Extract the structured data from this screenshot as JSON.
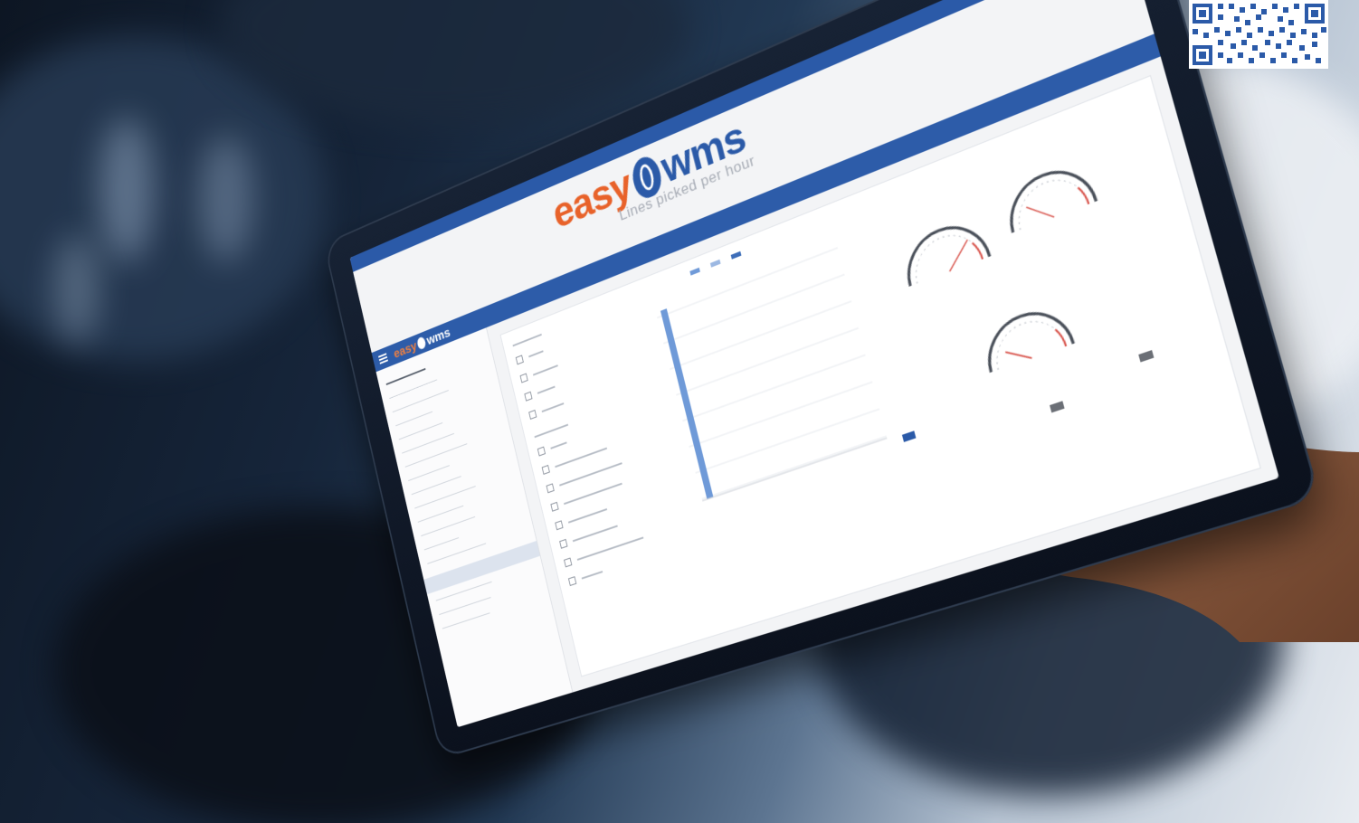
{
  "header": {
    "logo_easy": "easy",
    "logo_wms": "wms"
  },
  "appbar": {
    "logo_easy": "easy",
    "logo_wms": "wms"
  },
  "page": {
    "title": "Lines picked per hour"
  },
  "colors": {
    "brand_blue": "#2b5aa8",
    "brand_orange": "#e8622a",
    "chart_bar": "#6f9ad8"
  },
  "icons": {
    "menu": "hamburger-menu-icon",
    "qr": "qr-code-icon"
  }
}
